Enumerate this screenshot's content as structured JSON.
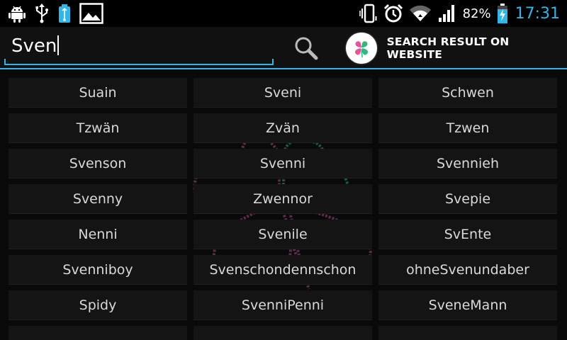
{
  "status_bar": {
    "left_icons": [
      "android-icon",
      "usb-icon",
      "usb-debug-icon",
      "image-icon"
    ],
    "right_icons": [
      "vibrate-icon",
      "alarm-icon",
      "wifi-icon",
      "signal-icon",
      "battery-icon"
    ],
    "battery_percent": "82%",
    "time": "17:31",
    "accent_color": "#33b5e5"
  },
  "search": {
    "value": "Sven",
    "search_button_icon": "search-icon",
    "website_button_label": "SEARCH RESULT ON WEBSITE",
    "website_button_icon": "clover-logo-icon"
  },
  "results": [
    [
      "Suain",
      "Sveni",
      "Schwen"
    ],
    [
      "Tzwän",
      "Zvän",
      "Tzwen"
    ],
    [
      "Svenson",
      "Svenni",
      "Svennieh"
    ],
    [
      "Svenny",
      "Zwennor",
      "Svepie"
    ],
    [
      "Nenni",
      "Svenile",
      "SvEnte"
    ],
    [
      "Svenniboy",
      "Svenschondennschon",
      "ohneSvenundaber"
    ],
    [
      "Spidy",
      "SvenniPenni",
      "SveneMann"
    ],
    [
      "",
      "",
      ""
    ]
  ]
}
